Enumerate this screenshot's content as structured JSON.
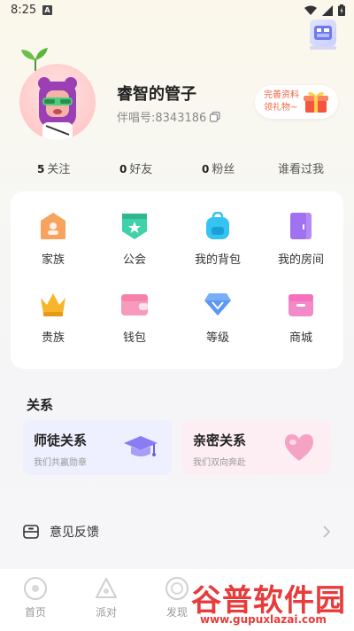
{
  "status_bar": {
    "time": "8:25",
    "notification_icon": "A"
  },
  "profile": {
    "username": "睿智的管子",
    "user_id": "伴唱号:8343186",
    "promo_line1": "完善资料",
    "promo_line2": "领礼物~"
  },
  "stats": [
    {
      "count": "5",
      "label": "关注"
    },
    {
      "count": "0",
      "label": "好友"
    },
    {
      "count": "0",
      "label": "粉丝"
    },
    {
      "count": "",
      "label": "谁看过我"
    }
  ],
  "grid": [
    {
      "label": "家族",
      "icon": "family-icon",
      "color": "#f7a25d"
    },
    {
      "label": "公会",
      "icon": "guild-icon",
      "color": "#3fd1a7"
    },
    {
      "label": "我的背包",
      "icon": "backpack-icon",
      "color": "#35c3f2"
    },
    {
      "label": "我的房间",
      "icon": "room-icon",
      "color": "#b48bf6"
    },
    {
      "label": "贵族",
      "icon": "crown-icon",
      "color": "#f7b52b"
    },
    {
      "label": "钱包",
      "icon": "wallet-icon",
      "color": "#f79abb"
    },
    {
      "label": "等级",
      "icon": "diamond-icon",
      "color": "#78aef9"
    },
    {
      "label": "商城",
      "icon": "shop-icon",
      "color": "#f28ac8"
    }
  ],
  "relations": {
    "title": "关系",
    "cards": [
      {
        "title": "师徒关系",
        "subtitle": "我们共赢勋章",
        "icon": "graduation-cap-icon",
        "bg": "#eef0ff"
      },
      {
        "title": "亲密关系",
        "subtitle": "我们双向奔赴",
        "icon": "heart-icon",
        "bg": "#fdeef4"
      }
    ]
  },
  "feedback": {
    "label": "意见反馈"
  },
  "tabs": [
    {
      "label": "首页"
    },
    {
      "label": "派对"
    },
    {
      "label": "发现"
    }
  ],
  "watermark": {
    "big": "谷普软件园",
    "small": "www.gupuxlazai.com"
  }
}
